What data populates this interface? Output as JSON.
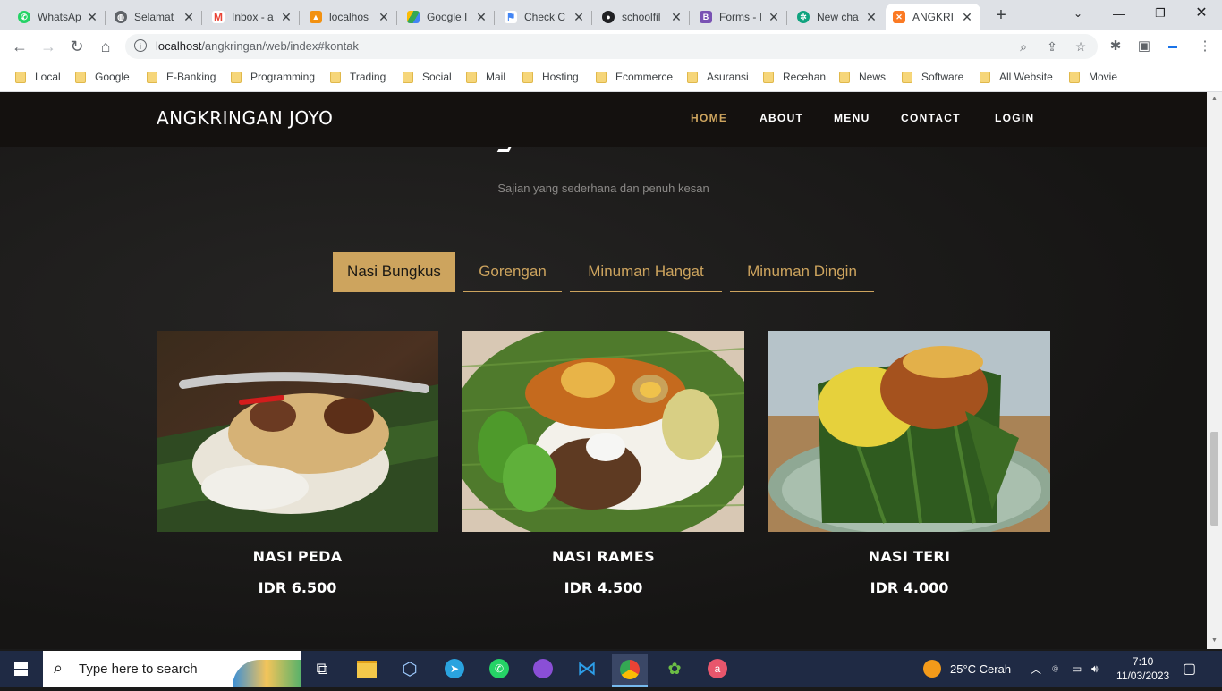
{
  "browser": {
    "tabs": [
      {
        "title": "WhatsAp",
        "icon": "whatsapp-icon",
        "color": "#25d366"
      },
      {
        "title": "Selamat",
        "icon": "globe-icon",
        "color": "#5f6368"
      },
      {
        "title": "Inbox - a",
        "icon": "gmail-icon",
        "color": "#ea4335"
      },
      {
        "title": "localhos",
        "icon": "phpmyadmin-icon",
        "color": "#f29111"
      },
      {
        "title": "Google I",
        "icon": "google-drive-icon",
        "color": "#34a853"
      },
      {
        "title": "Check C",
        "icon": "flag-icon",
        "color": "#4285f4"
      },
      {
        "title": "schoolfil",
        "icon": "github-icon",
        "color": "#202124"
      },
      {
        "title": "Forms - I",
        "icon": "bootstrap-icon",
        "color": "#7952b3"
      },
      {
        "title": "New cha",
        "icon": "chatgpt-icon",
        "color": "#10a37f"
      },
      {
        "title": "ANGKRI",
        "icon": "xampp-icon",
        "color": "#fb7a24"
      }
    ],
    "url_host": "localhost",
    "url_path": "/angkringan/web/index#kontak",
    "bookmarks": [
      "Local",
      "Google",
      "E-Banking",
      "Programming",
      "Trading",
      "Social",
      "Mail",
      "Hosting",
      "Ecommerce",
      "Asuransi",
      "Recehan",
      "News",
      "Software",
      "All Website",
      "Movie"
    ]
  },
  "site": {
    "brand": "ANGKRINGAN JOYO",
    "nav": [
      "HOME",
      "ABOUT",
      "MENU",
      "CONTACT",
      "LOGIN"
    ],
    "subtitle": "Sajian yang sederhana dan penuh kesan",
    "filters": [
      "Nasi Bungkus",
      "Gorengan",
      "Minuman Hangat",
      "Minuman Dingin"
    ],
    "active_filter": "Nasi Bungkus",
    "accent_color": "#cda45e",
    "items": [
      {
        "name": "NASI PEDA",
        "price": "IDR 6.500"
      },
      {
        "name": "NASI RAMES",
        "price": "IDR 4.500"
      },
      {
        "name": "NASI TERI",
        "price": "IDR 4.000"
      }
    ]
  },
  "taskbar": {
    "search_placeholder": "Type here to search",
    "weather": "25°C  Cerah",
    "time": "7:10",
    "date": "11/03/2023"
  }
}
